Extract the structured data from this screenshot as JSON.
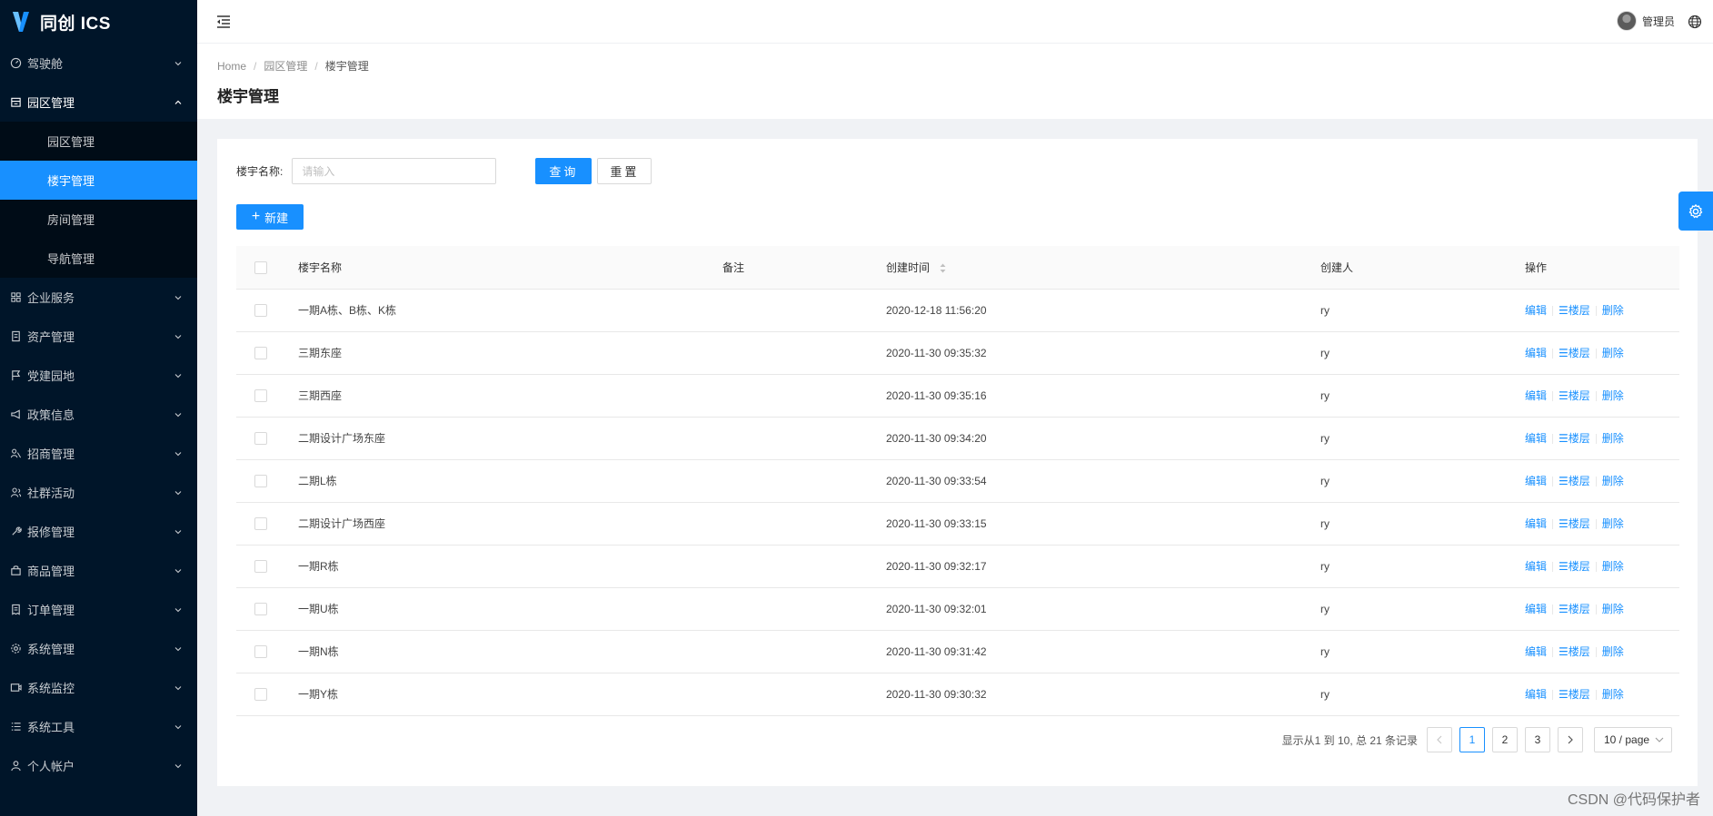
{
  "app": {
    "name": "同创 ICS"
  },
  "sidebar": {
    "items": [
      {
        "label": "驾驶舱",
        "icon": "dashboard-icon",
        "open": false
      },
      {
        "label": "园区管理",
        "icon": "building-icon",
        "open": true,
        "children": [
          {
            "label": "园区管理",
            "active": false
          },
          {
            "label": "楼宇管理",
            "active": true
          },
          {
            "label": "房间管理",
            "active": false
          },
          {
            "label": "导航管理",
            "active": false
          }
        ]
      },
      {
        "label": "企业服务",
        "icon": "grid-icon",
        "open": false
      },
      {
        "label": "资产管理",
        "icon": "document-icon",
        "open": false
      },
      {
        "label": "党建园地",
        "icon": "flag-icon",
        "open": false
      },
      {
        "label": "政策信息",
        "icon": "megaphone-icon",
        "open": false
      },
      {
        "label": "招商管理",
        "icon": "people-icon",
        "open": false
      },
      {
        "label": "社群活动",
        "icon": "user-group-icon",
        "open": false
      },
      {
        "label": "报修管理",
        "icon": "wrench-icon",
        "open": false
      },
      {
        "label": "商品管理",
        "icon": "shop-icon",
        "open": false
      },
      {
        "label": "订单管理",
        "icon": "receipt-icon",
        "open": false
      },
      {
        "label": "系统管理",
        "icon": "gear-icon",
        "open": false
      },
      {
        "label": "系统监控",
        "icon": "monitor-icon",
        "open": false
      },
      {
        "label": "系统工具",
        "icon": "list-icon",
        "open": false
      },
      {
        "label": "个人帐户",
        "icon": "user-icon",
        "open": false
      }
    ]
  },
  "header": {
    "user_name": "管理员"
  },
  "breadcrumb": {
    "home": "Home",
    "parent": "园区管理",
    "current": "楼宇管理"
  },
  "page": {
    "title": "楼宇管理"
  },
  "query": {
    "label": "楼宇名称:",
    "placeholder": "请输入",
    "value": "",
    "search_label": "查询",
    "reset_label": "重置"
  },
  "actions": {
    "new_label": "新建"
  },
  "table": {
    "columns": {
      "name": "楼宇名称",
      "remark": "备注",
      "created_at": "创建时间",
      "creator": "创建人",
      "ops": "操作"
    },
    "op_labels": {
      "edit": "编辑",
      "floors": "楼层",
      "delete": "删除"
    },
    "rows": [
      {
        "name": "一期A栋、B栋、K栋",
        "remark": "",
        "created_at": "2020-12-18 11:56:20",
        "creator": "ry"
      },
      {
        "name": "三期东座",
        "remark": "",
        "created_at": "2020-11-30 09:35:32",
        "creator": "ry"
      },
      {
        "name": "三期西座",
        "remark": "",
        "created_at": "2020-11-30 09:35:16",
        "creator": "ry"
      },
      {
        "name": "二期设计广场东座",
        "remark": "",
        "created_at": "2020-11-30 09:34:20",
        "creator": "ry"
      },
      {
        "name": "二期L栋",
        "remark": "",
        "created_at": "2020-11-30 09:33:54",
        "creator": "ry"
      },
      {
        "name": "二期设计广场西座",
        "remark": "",
        "created_at": "2020-11-30 09:33:15",
        "creator": "ry"
      },
      {
        "name": "一期R栋",
        "remark": "",
        "created_at": "2020-11-30 09:32:17",
        "creator": "ry"
      },
      {
        "name": "一期U栋",
        "remark": "",
        "created_at": "2020-11-30 09:32:01",
        "creator": "ry"
      },
      {
        "name": "一期N栋",
        "remark": "",
        "created_at": "2020-11-30 09:31:42",
        "creator": "ry"
      },
      {
        "name": "一期Y栋",
        "remark": "",
        "created_at": "2020-11-30 09:30:32",
        "creator": "ry"
      }
    ]
  },
  "pagination": {
    "total_text": "显示从1 到 10, 总 21 条记录",
    "pages": [
      "1",
      "2",
      "3"
    ],
    "current": "1",
    "page_size": "10 / page"
  },
  "watermark": "CSDN @代码保护者",
  "colors": {
    "primary": "#1890ff",
    "sidebar_bg": "#001529"
  }
}
